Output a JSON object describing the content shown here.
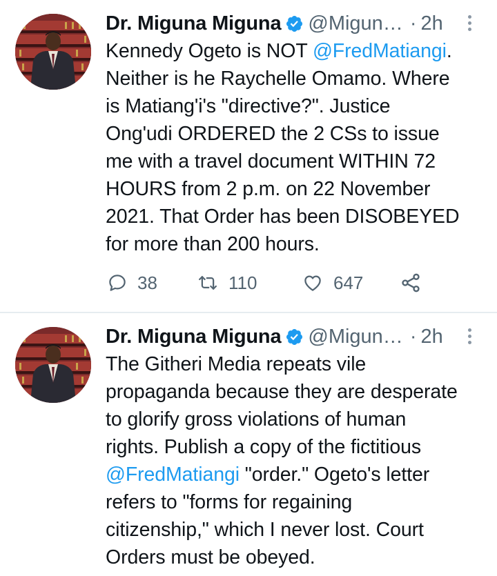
{
  "tweets": [
    {
      "author": {
        "display_name": "Dr. Miguna Miguna",
        "handle": "@Migun…",
        "verified": true
      },
      "time": "2h",
      "separator": "·",
      "text_lines": [
        [
          "Kennedy Ogeto is NOT ",
          "@FredMatiangi",
          "."
        ],
        [
          "Neither is he Raychelle Omamo. Where"
        ],
        [
          "is Matiang'i's \"directive?\". Justice"
        ],
        [
          "Ong'udi ORDERED the 2 CSs to issue"
        ],
        [
          "me with a travel document WITHIN 72"
        ],
        [
          "HOURS from 2 p.m. on 22 November"
        ],
        [
          "2021. That Order has been DISOBEYED"
        ],
        [
          "for more than 200 hours."
        ]
      ],
      "metrics": {
        "replies": "38",
        "retweets": "110",
        "likes": "647"
      }
    },
    {
      "author": {
        "display_name": "Dr. Miguna Miguna",
        "handle": "@Migun…",
        "verified": true
      },
      "time": "2h",
      "separator": "·",
      "text_lines": [
        [
          "The Githeri Media repeats vile"
        ],
        [
          "propaganda because they are desperate"
        ],
        [
          "to glorify gross violations of human"
        ],
        [
          "rights. Publish a copy of the fictitious"
        ],
        [
          "",
          "@FredMatiangi",
          " \"order.\" Ogeto's letter"
        ],
        [
          "refers to \"forms for regaining"
        ],
        [
          "citizenship,\" which I never lost. Court"
        ],
        [
          "Orders must be obeyed."
        ]
      ]
    }
  ],
  "icons": {
    "verified": "verified-badge-icon",
    "more": "more-options-icon",
    "reply": "reply-icon",
    "retweet": "retweet-icon",
    "like": "heart-icon",
    "share": "share-icon"
  },
  "colors": {
    "link": "#1d9bf0",
    "muted": "#536471",
    "text": "#0f1419",
    "verified": "#1d9bf0",
    "divider": "#e6ecf0"
  }
}
